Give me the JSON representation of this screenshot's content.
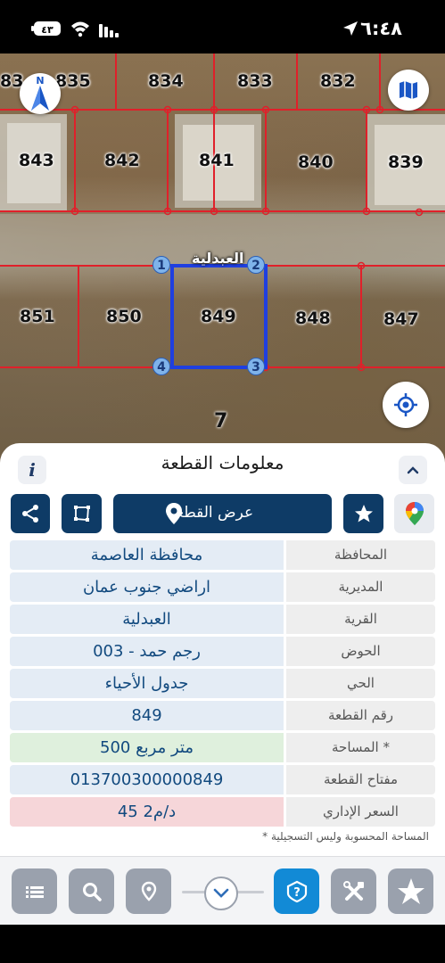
{
  "status_bar": {
    "time": "٦:٤٨",
    "battery": "٤٣"
  },
  "map": {
    "parcels_top": [
      "835",
      "834",
      "833",
      "832",
      "843",
      "842",
      "841",
      "840",
      "839"
    ],
    "parcels_mid": [
      "851",
      "850",
      "849",
      "848",
      "847"
    ],
    "corner_points": [
      "1",
      "2",
      "3",
      "4"
    ],
    "street_label": "العبدلية",
    "block_number": "7",
    "compass_label": "N",
    "edge_label": "83"
  },
  "sheet": {
    "title": "معلومات القطعة",
    "view_button_label": "عرض القطعة",
    "rows": [
      {
        "label": "المحافظة",
        "value": "محافظة العاصمة"
      },
      {
        "label": "المديرية",
        "value": "اراضي جنوب عمان"
      },
      {
        "label": "القرية",
        "value": "العبدلية"
      },
      {
        "label": "الحوض",
        "value": "رجم حمد - 003"
      },
      {
        "label": "الحي",
        "value": "جدول الأحياء"
      },
      {
        "label": "رقم القطعة",
        "value": "849"
      },
      {
        "label": "المساحة *",
        "value": "500   متر مربع"
      },
      {
        "label": "مفتاح القطعة",
        "value": "013700300000849"
      },
      {
        "label": "السعر الإداري",
        "value": "45 د/م2"
      }
    ],
    "footnote": "* المساحة المحسوبة وليس التسجيلية"
  },
  "colors": {
    "primary": "#0e3b66",
    "accent": "#128ad6",
    "value_text": "#124a7f",
    "parcel_line": "#e0202a",
    "selected_parcel": "#1f3fe0"
  },
  "icons": {
    "share": "share-icon",
    "bounds": "crop-frame-icon",
    "view": "location-pin-icon",
    "star": "star-icon",
    "gmap": "google-maps-icon",
    "list": "list-icon",
    "search": "search-icon",
    "pin": "pin-icon",
    "chevron": "chevron-down-icon",
    "help": "help-icon",
    "tools": "tools-icon",
    "logo": "app-logo-icon"
  }
}
